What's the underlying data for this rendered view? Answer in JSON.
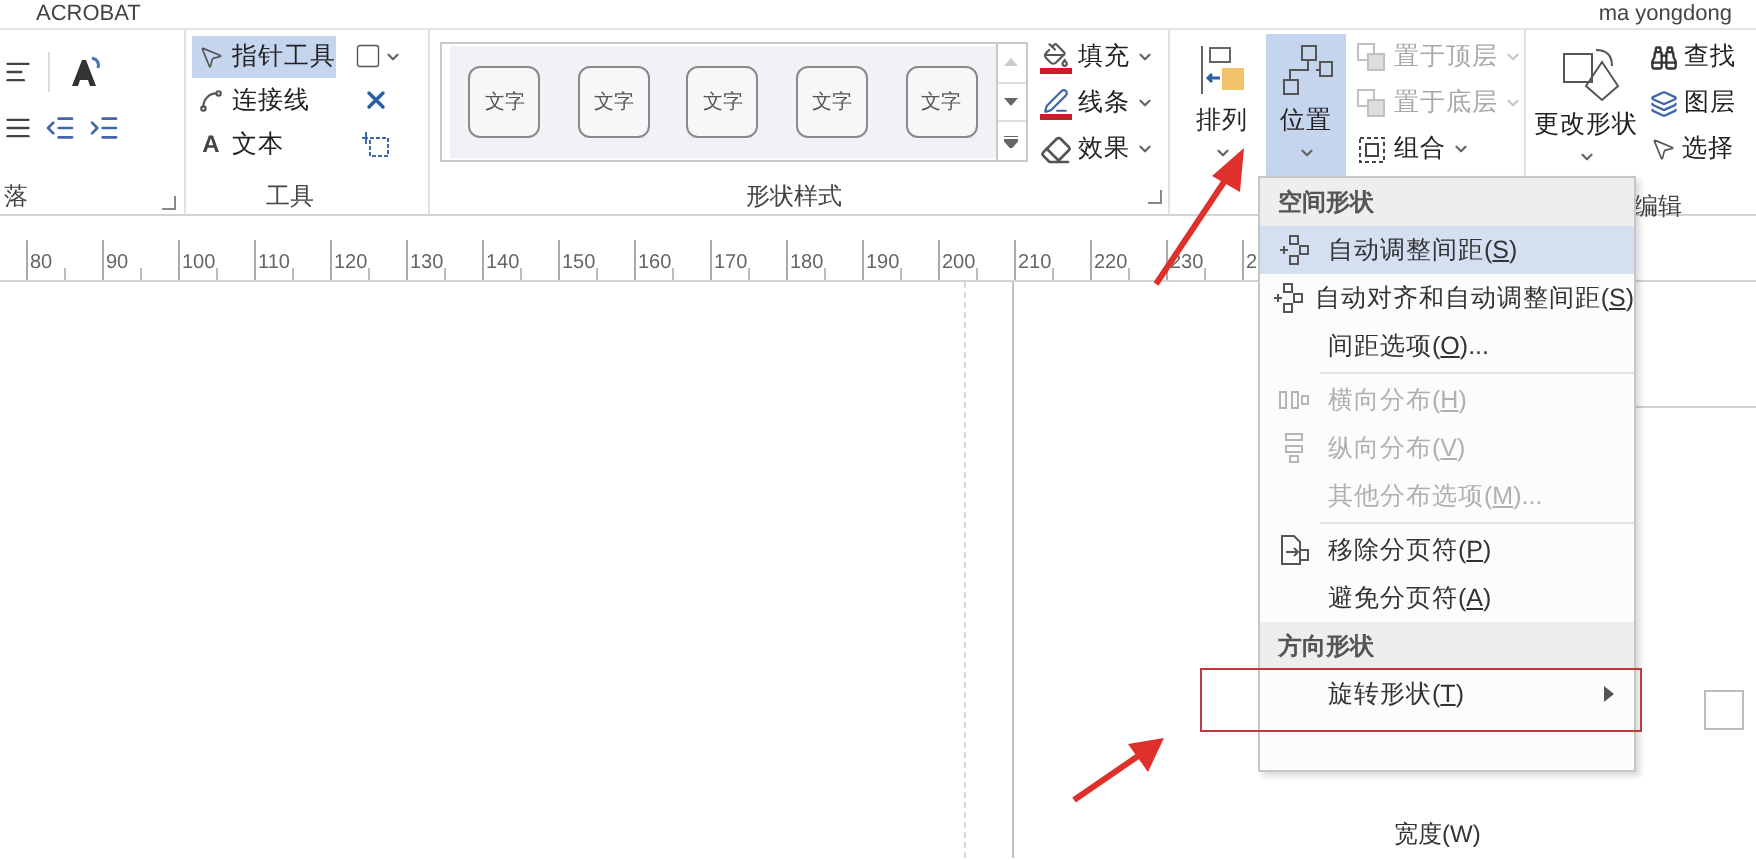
{
  "title_bar": {
    "app": "ACROBAT",
    "user": "ma yongdong"
  },
  "paragraph_group": {
    "label": "落"
  },
  "tools_group": {
    "label": "工具",
    "items": [
      {
        "label": "指针工具",
        "selected": true
      },
      {
        "label": "连接线",
        "selected": false
      },
      {
        "label": "文本",
        "selected": false,
        "glyph": "A"
      }
    ]
  },
  "shape_styles_group": {
    "label": "形状样式",
    "thumbnails": [
      "文字",
      "文字",
      "文字",
      "文字",
      "文字"
    ],
    "options": [
      {
        "label": "填充"
      },
      {
        "label": "线条"
      },
      {
        "label": "效果"
      }
    ]
  },
  "arrange_group": {
    "big_buttons": [
      {
        "label": "排列",
        "selected": false
      },
      {
        "label": "位置",
        "selected": true
      }
    ],
    "small_buttons": [
      {
        "label": "置于顶层",
        "disabled": true
      },
      {
        "label": "置于底层",
        "disabled": true
      },
      {
        "label": "组合",
        "disabled": false
      }
    ]
  },
  "edit_group": {
    "label": "编辑",
    "big_button": "更改形状",
    "small_buttons": [
      "查找",
      "图层",
      "选择"
    ]
  },
  "ruler": [
    "80",
    "90",
    "100",
    "110",
    "120",
    "130",
    "140",
    "150",
    "160",
    "170",
    "180",
    "190",
    "200",
    "210",
    "220",
    "230",
    "2"
  ],
  "panel": {
    "field_label": "宽度(W)"
  },
  "position_menu": [
    {
      "kind": "header",
      "text": "空间形状"
    },
    {
      "kind": "item",
      "text": "自动调整间距(",
      "key": "S",
      "tail": ")",
      "selected": true,
      "disabled": false
    },
    {
      "kind": "item",
      "text": "自动对齐和自动调整间距(",
      "key": "S",
      "tail": ")",
      "selected": false,
      "disabled": false
    },
    {
      "kind": "item",
      "text": "间距选项(",
      "key": "O",
      "tail": ")...",
      "selected": false,
      "disabled": false
    },
    {
      "kind": "separator"
    },
    {
      "kind": "item",
      "text": "横向分布(",
      "key": "H",
      "tail": ")",
      "selected": false,
      "disabled": true
    },
    {
      "kind": "item",
      "text": "纵向分布(",
      "key": "V",
      "tail": ")",
      "selected": false,
      "disabled": true
    },
    {
      "kind": "item",
      "text": "其他分布选项(",
      "key": "M",
      "tail": ")...",
      "selected": false,
      "disabled": true
    },
    {
      "kind": "separator"
    },
    {
      "kind": "item",
      "text": "移除分页符(",
      "key": "P",
      "tail": ")",
      "selected": false,
      "disabled": false
    },
    {
      "kind": "item",
      "text": "避免分页符(",
      "key": "A",
      "tail": ")",
      "selected": false,
      "disabled": false
    },
    {
      "kind": "header",
      "text": "方向形状"
    },
    {
      "kind": "item",
      "text": "旋转形状(",
      "key": "T",
      "tail": ")",
      "selected": false,
      "disabled": false,
      "submenu": true
    }
  ]
}
